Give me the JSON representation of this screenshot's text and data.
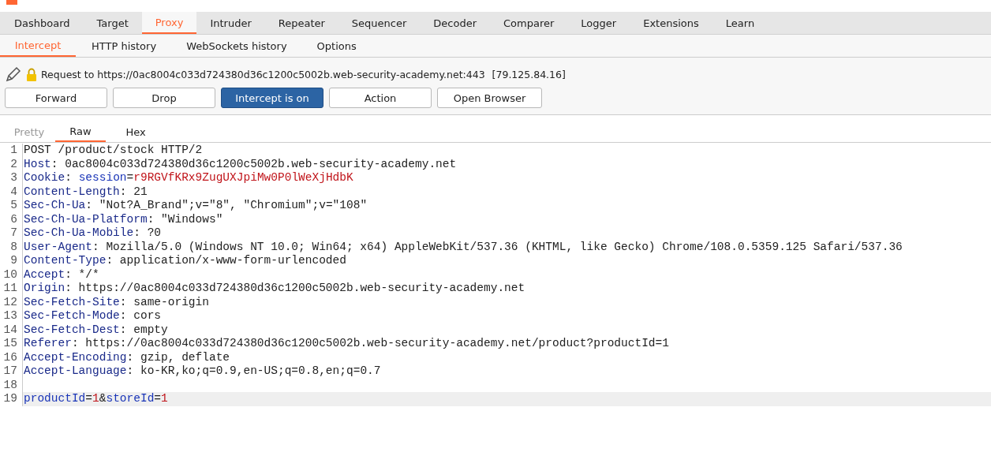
{
  "main_tabs": [
    {
      "label": "Dashboard",
      "selected": false
    },
    {
      "label": "Target",
      "selected": false
    },
    {
      "label": "Proxy",
      "selected": true
    },
    {
      "label": "Intruder",
      "selected": false
    },
    {
      "label": "Repeater",
      "selected": false
    },
    {
      "label": "Sequencer",
      "selected": false
    },
    {
      "label": "Decoder",
      "selected": false
    },
    {
      "label": "Comparer",
      "selected": false
    },
    {
      "label": "Logger",
      "selected": false
    },
    {
      "label": "Extensions",
      "selected": false
    },
    {
      "label": "Learn",
      "selected": false
    }
  ],
  "sub_tabs": [
    {
      "label": "Intercept",
      "selected": true
    },
    {
      "label": "HTTP history",
      "selected": false
    },
    {
      "label": "WebSockets history",
      "selected": false
    },
    {
      "label": "Options",
      "selected": false
    }
  ],
  "request": {
    "label": "Request to https://0ac8004c033d724380d36c1200c5002b.web-security-academy.net:443",
    "ip": "[79.125.84.16]"
  },
  "buttons": [
    {
      "label": "Forward",
      "selected": false
    },
    {
      "label": "Drop",
      "selected": false
    },
    {
      "label": "Intercept is on",
      "selected": true
    },
    {
      "label": "Action",
      "selected": false
    },
    {
      "label": "Open Browser",
      "selected": false
    }
  ],
  "editor_tabs": [
    {
      "label": "Pretty",
      "selected": false,
      "disabled": true
    },
    {
      "label": "Raw",
      "selected": true,
      "disabled": false
    },
    {
      "label": "Hex",
      "selected": false,
      "disabled": false
    }
  ],
  "lines": [
    {
      "number": "1",
      "current": false,
      "segments": [
        {
          "text": "POST /product/stock HTTP/2",
          "kind": "plain"
        }
      ]
    },
    {
      "number": "2",
      "current": false,
      "segments": [
        {
          "text": "Host",
          "kind": "name"
        },
        {
          "text": ": 0ac8004c033d724380d36c1200c5002b.web-security-academy.net",
          "kind": "plain"
        }
      ]
    },
    {
      "number": "3",
      "current": false,
      "segments": [
        {
          "text": "Cookie",
          "kind": "name"
        },
        {
          "text": ": ",
          "kind": "plain"
        },
        {
          "text": "session",
          "kind": "param"
        },
        {
          "text": "=",
          "kind": "plain"
        },
        {
          "text": "r9RGVfKRx9ZugUXJpiMw0P0lWeXjHdbK",
          "kind": "value"
        }
      ]
    },
    {
      "number": "4",
      "current": false,
      "segments": [
        {
          "text": "Content-Length",
          "kind": "name"
        },
        {
          "text": ": 21",
          "kind": "plain"
        }
      ]
    },
    {
      "number": "5",
      "current": false,
      "segments": [
        {
          "text": "Sec-Ch-Ua",
          "kind": "name"
        },
        {
          "text": ": \"Not?A_Brand\";v=\"8\", \"Chromium\";v=\"108\"",
          "kind": "plain"
        }
      ]
    },
    {
      "number": "6",
      "current": false,
      "segments": [
        {
          "text": "Sec-Ch-Ua-Platform",
          "kind": "name"
        },
        {
          "text": ": \"Windows\"",
          "kind": "plain"
        }
      ]
    },
    {
      "number": "7",
      "current": false,
      "segments": [
        {
          "text": "Sec-Ch-Ua-Mobile",
          "kind": "name"
        },
        {
          "text": ": ?0",
          "kind": "plain"
        }
      ]
    },
    {
      "number": "8",
      "current": false,
      "segments": [
        {
          "text": "User-Agent",
          "kind": "name"
        },
        {
          "text": ": Mozilla/5.0 (Windows NT 10.0; Win64; x64) AppleWebKit/537.36 (KHTML, like Gecko) Chrome/108.0.5359.125 Safari/537.36",
          "kind": "plain"
        }
      ]
    },
    {
      "number": "9",
      "current": false,
      "segments": [
        {
          "text": "Content-Type",
          "kind": "name"
        },
        {
          "text": ": application/x-www-form-urlencoded",
          "kind": "plain"
        }
      ]
    },
    {
      "number": "10",
      "current": false,
      "segments": [
        {
          "text": "Accept",
          "kind": "name"
        },
        {
          "text": ": */*",
          "kind": "plain"
        }
      ]
    },
    {
      "number": "11",
      "current": false,
      "segments": [
        {
          "text": "Origin",
          "kind": "name"
        },
        {
          "text": ": https://0ac8004c033d724380d36c1200c5002b.web-security-academy.net",
          "kind": "plain"
        }
      ]
    },
    {
      "number": "12",
      "current": false,
      "segments": [
        {
          "text": "Sec-Fetch-Site",
          "kind": "name"
        },
        {
          "text": ": same-origin",
          "kind": "plain"
        }
      ]
    },
    {
      "number": "13",
      "current": false,
      "segments": [
        {
          "text": "Sec-Fetch-Mode",
          "kind": "name"
        },
        {
          "text": ": cors",
          "kind": "plain"
        }
      ]
    },
    {
      "number": "14",
      "current": false,
      "segments": [
        {
          "text": "Sec-Fetch-Dest",
          "kind": "name"
        },
        {
          "text": ": empty",
          "kind": "plain"
        }
      ]
    },
    {
      "number": "15",
      "current": false,
      "segments": [
        {
          "text": "Referer",
          "kind": "name"
        },
        {
          "text": ": https://0ac8004c033d724380d36c1200c5002b.web-security-academy.net/product?productId=1",
          "kind": "plain"
        }
      ]
    },
    {
      "number": "16",
      "current": false,
      "segments": [
        {
          "text": "Accept-Encoding",
          "kind": "name"
        },
        {
          "text": ": gzip, deflate",
          "kind": "plain"
        }
      ]
    },
    {
      "number": "17",
      "current": false,
      "segments": [
        {
          "text": "Accept-Language",
          "kind": "name"
        },
        {
          "text": ": ko-KR,ko;q=0.9,en-US;q=0.8,en;q=0.7",
          "kind": "plain"
        }
      ]
    },
    {
      "number": "18",
      "current": false
    },
    {
      "number": "19",
      "current": true,
      "segments": [
        {
          "text": "productId",
          "kind": "param"
        },
        {
          "text": "=",
          "kind": "plain"
        },
        {
          "text": "1",
          "kind": "value"
        },
        {
          "text": "&",
          "kind": "plain"
        },
        {
          "text": "storeId",
          "kind": "param"
        },
        {
          "text": "=",
          "kind": "plain"
        },
        {
          "text": "1",
          "kind": "value"
        }
      ]
    }
  ]
}
